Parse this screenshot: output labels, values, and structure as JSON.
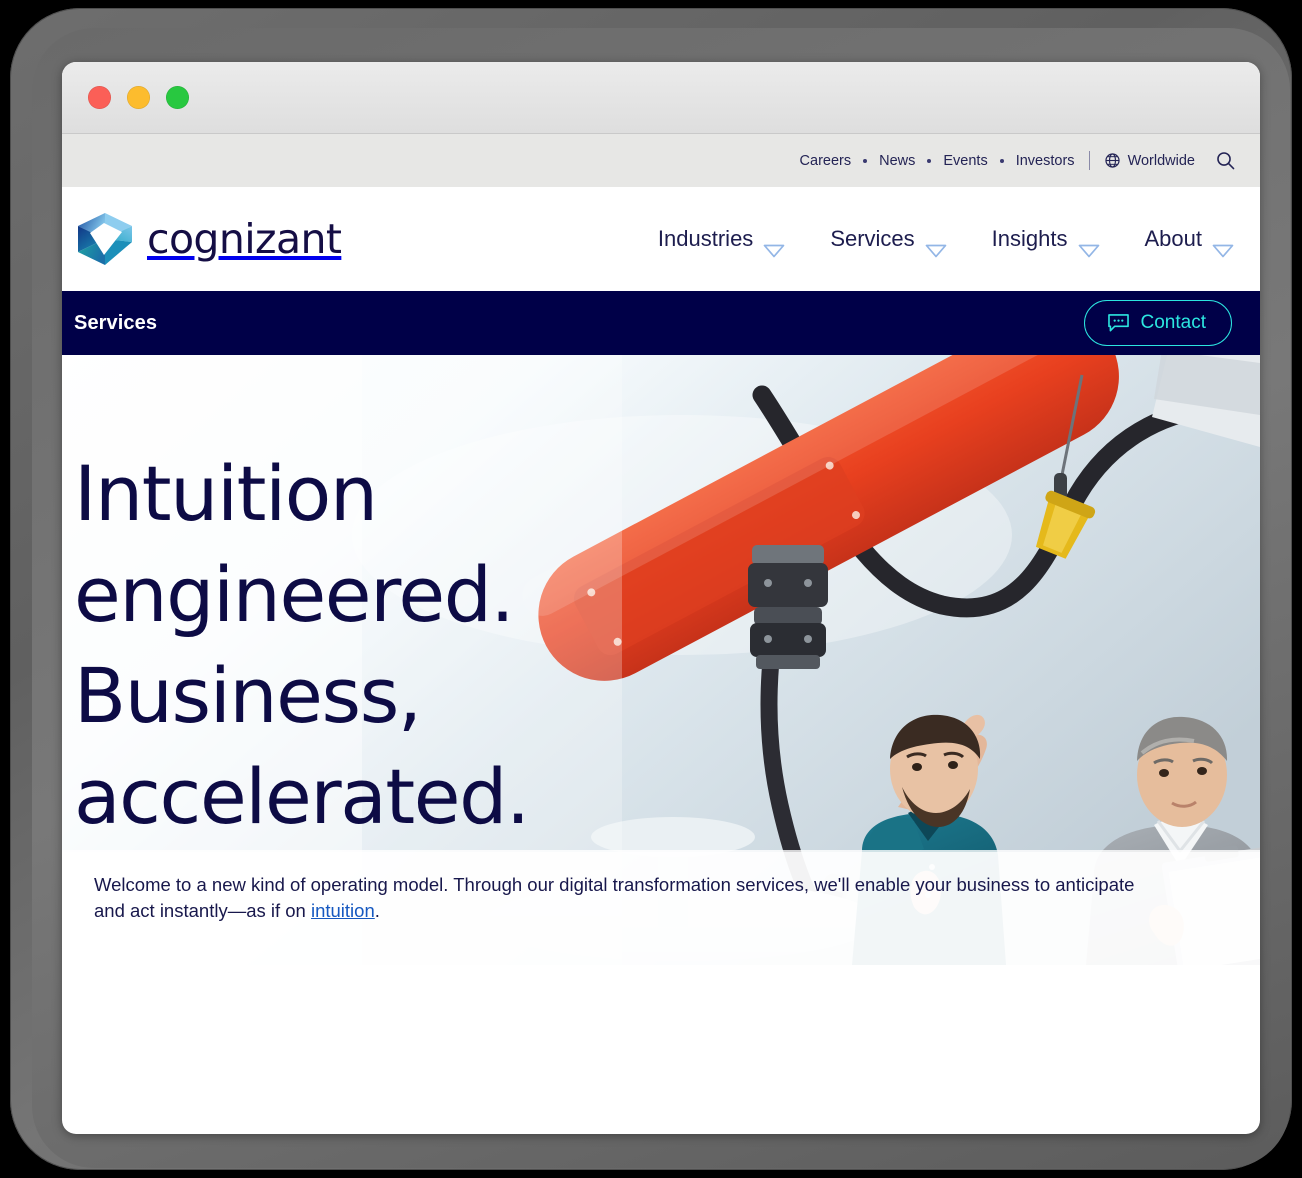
{
  "window": {
    "traffic_lights": [
      {
        "name": "close",
        "color": "#fb5f57"
      },
      {
        "name": "minimize",
        "color": "#fcbc2e"
      },
      {
        "name": "maximize",
        "color": "#28c840"
      }
    ]
  },
  "utility_bar": {
    "links": [
      "Careers",
      "News",
      "Events",
      "Investors"
    ],
    "region_label": "Worldwide",
    "region_icon": "globe-icon",
    "search_icon": "search-icon"
  },
  "brand": {
    "wordmark": "cognizant",
    "logo_icon": "cognizant-cube-logo",
    "logo_colors": {
      "dark_blue": "#12357a",
      "mid_blue": "#2f6fc0",
      "light_blue": "#7fc3ea",
      "teal": "#1fa9a0"
    }
  },
  "main_nav": {
    "items": [
      {
        "label": "Industries",
        "icon": "chevron-down-icon"
      },
      {
        "label": "Services",
        "icon": "chevron-down-icon"
      },
      {
        "label": "Insights",
        "icon": "chevron-down-icon"
      },
      {
        "label": "About",
        "icon": "chevron-down-icon"
      }
    ]
  },
  "section_bar": {
    "title": "Services",
    "background": "#000048",
    "contact": {
      "label": "Contact",
      "icon": "chat-bubble-icon",
      "accent": "#2ce6e0"
    }
  },
  "hero": {
    "heading_lines": [
      "Intuition",
      "engineered.",
      "Business,",
      "accelerated."
    ],
    "heading_color": "#0d0b45",
    "image_description": "Two men in a lab looking up at a large red-orange industrial robotic arm",
    "image_colors": {
      "robot_arm": "#e8401f",
      "cable": "#232329",
      "clamp": "#e0b616",
      "polo_shirt": "#18697e",
      "sweater": "#9a9fa6",
      "wall": "#dde6ec"
    }
  },
  "intro": {
    "text_before_link": "Welcome to a new kind of operating model. Through our digital transformation services, we'll enable your business to anticipate and act instantly—as if on ",
    "link_text": "intuition",
    "text_after_link": ".",
    "link_color": "#1558c0"
  }
}
